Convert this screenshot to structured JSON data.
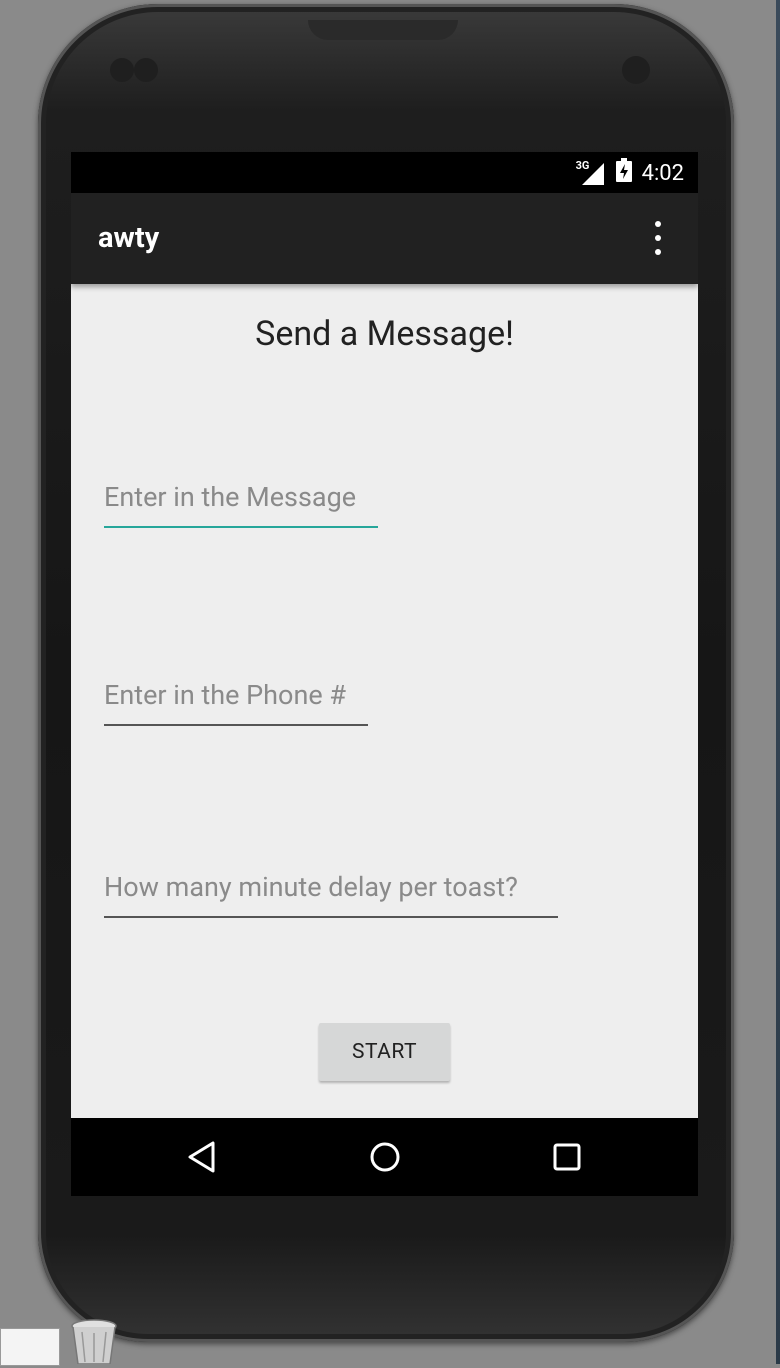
{
  "status_bar": {
    "network_label": "3G",
    "time": "4:02"
  },
  "app_bar": {
    "title": "awty",
    "overflow_icon": "more-vert-icon"
  },
  "main": {
    "heading": "Send a Message!",
    "message_field": {
      "value": "",
      "placeholder": "Enter in the Message"
    },
    "phone_field": {
      "value": "",
      "placeholder": "Enter in the Phone #"
    },
    "delay_field": {
      "value": "",
      "placeholder": "How many minute delay per toast?"
    },
    "start_button": "START"
  },
  "nav_bar": {
    "back_icon": "back-triangle-icon",
    "home_icon": "home-circle-icon",
    "recents_icon": "recents-square-icon"
  },
  "colors": {
    "accent": "#26a69a",
    "app_bar": "#212121",
    "content_bg": "#eeeeee",
    "button_bg": "#d6d7d7"
  }
}
